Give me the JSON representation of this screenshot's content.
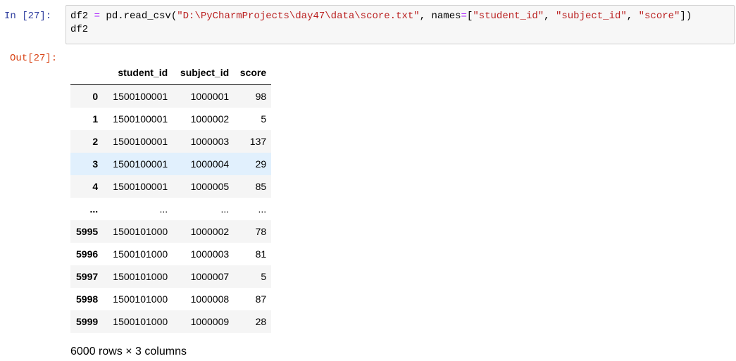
{
  "cell": {
    "in_prompt": "In  [27]:",
    "out_prompt": "Out[27]:",
    "code": {
      "l1_a": "df2 ",
      "l1_eq": "=",
      "l1_b": " pd.read_csv(",
      "l1_path": "\"D:\\PyCharmProjects\\day47\\data\\score.txt\"",
      "l1_c": ", names",
      "l1_eq2": "=",
      "l1_d": "[",
      "l1_s1": "\"student_id\"",
      "l1_e": ", ",
      "l1_s2": "\"subject_id\"",
      "l1_f": ", ",
      "l1_s3": "\"score\"",
      "l1_g": "])",
      "l2": "df2"
    }
  },
  "dataframe": {
    "columns": [
      "student_id",
      "subject_id",
      "score"
    ],
    "rows": [
      {
        "index": "0",
        "student_id": "1500100001",
        "subject_id": "1000001",
        "score": "98"
      },
      {
        "index": "1",
        "student_id": "1500100001",
        "subject_id": "1000002",
        "score": "5"
      },
      {
        "index": "2",
        "student_id": "1500100001",
        "subject_id": "1000003",
        "score": "137"
      },
      {
        "index": "3",
        "student_id": "1500100001",
        "subject_id": "1000004",
        "score": "29"
      },
      {
        "index": "4",
        "student_id": "1500100001",
        "subject_id": "1000005",
        "score": "85"
      },
      {
        "index": "...",
        "student_id": "...",
        "subject_id": "...",
        "score": "..."
      },
      {
        "index": "5995",
        "student_id": "1500101000",
        "subject_id": "1000002",
        "score": "78"
      },
      {
        "index": "5996",
        "student_id": "1500101000",
        "subject_id": "1000003",
        "score": "81"
      },
      {
        "index": "5997",
        "student_id": "1500101000",
        "subject_id": "1000007",
        "score": "5"
      },
      {
        "index": "5998",
        "student_id": "1500101000",
        "subject_id": "1000008",
        "score": "87"
      },
      {
        "index": "5999",
        "student_id": "1500101000",
        "subject_id": "1000009",
        "score": "28"
      }
    ],
    "highlighted_row": 3,
    "shape_text": "6000 rows × 3 columns"
  },
  "colors": {
    "in_prompt": "#303f9f",
    "out_prompt": "#d84315",
    "input_bg": "#f7f7f7",
    "string": "#ba2121",
    "operator": "#aa22ff",
    "row_hover": "#e1f0fd",
    "row_striped": "#f5f5f5"
  }
}
